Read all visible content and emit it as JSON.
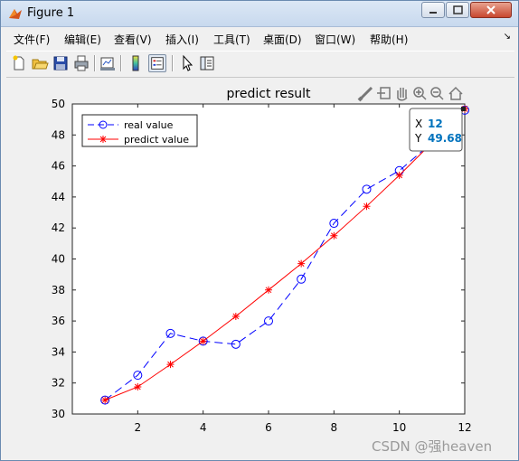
{
  "window": {
    "title": "Figure 1",
    "buttons": {
      "min": "minimize",
      "max": "maximize",
      "close": "close"
    }
  },
  "menu": [
    "文件(F)",
    "编辑(E)",
    "查看(V)",
    "插入(I)",
    "工具(T)",
    "桌面(D)",
    "窗口(W)",
    "帮助(H)"
  ],
  "menu_overflow": "↘",
  "toolbar": [
    "new-figure-icon",
    "open-file-icon",
    "save-icon",
    "print-icon",
    "link-plot-icon",
    "colorbar-icon",
    "legend-icon",
    "pointer-icon",
    "property-editor-icon"
  ],
  "axes_toolbar": [
    "brush-icon",
    "export-icon",
    "pan-icon",
    "zoom-in-icon",
    "zoom-out-icon",
    "home-icon"
  ],
  "datatip": {
    "x_label": "X",
    "x_value": "12",
    "y_label": "Y",
    "y_value": "49.68"
  },
  "watermark": "CSDN @强heaven",
  "colors": {
    "real": "#0000ff",
    "predict": "#ff0000",
    "datatip_value": "#0072bd"
  },
  "chart_data": {
    "type": "line",
    "title": "predict result",
    "xlabel": "",
    "ylabel": "",
    "xlim": [
      0,
      12
    ],
    "ylim": [
      30,
      50
    ],
    "xticks": [
      2,
      4,
      6,
      8,
      10,
      12
    ],
    "yticks": [
      30,
      32,
      34,
      36,
      38,
      40,
      42,
      44,
      46,
      48,
      50
    ],
    "grid": false,
    "legend_position": "top-left",
    "series": [
      {
        "name": "real value",
        "style": "dashed",
        "marker": "circle",
        "color": "#0000ff",
        "x": [
          1,
          2,
          3,
          4,
          5,
          6,
          7,
          8,
          9,
          10,
          11,
          12
        ],
        "y": [
          30.9,
          32.5,
          35.2,
          34.7,
          34.5,
          36.0,
          38.7,
          42.3,
          44.5,
          45.7,
          47.5,
          49.6
        ]
      },
      {
        "name": "predict value",
        "style": "solid",
        "marker": "asterisk",
        "color": "#ff0000",
        "x": [
          1,
          2,
          3,
          4,
          5,
          6,
          7,
          8,
          9,
          10,
          11,
          12
        ],
        "y": [
          30.9,
          31.75,
          33.2,
          34.7,
          36.3,
          38.0,
          39.7,
          41.5,
          43.4,
          45.4,
          47.5,
          49.68
        ]
      }
    ]
  }
}
